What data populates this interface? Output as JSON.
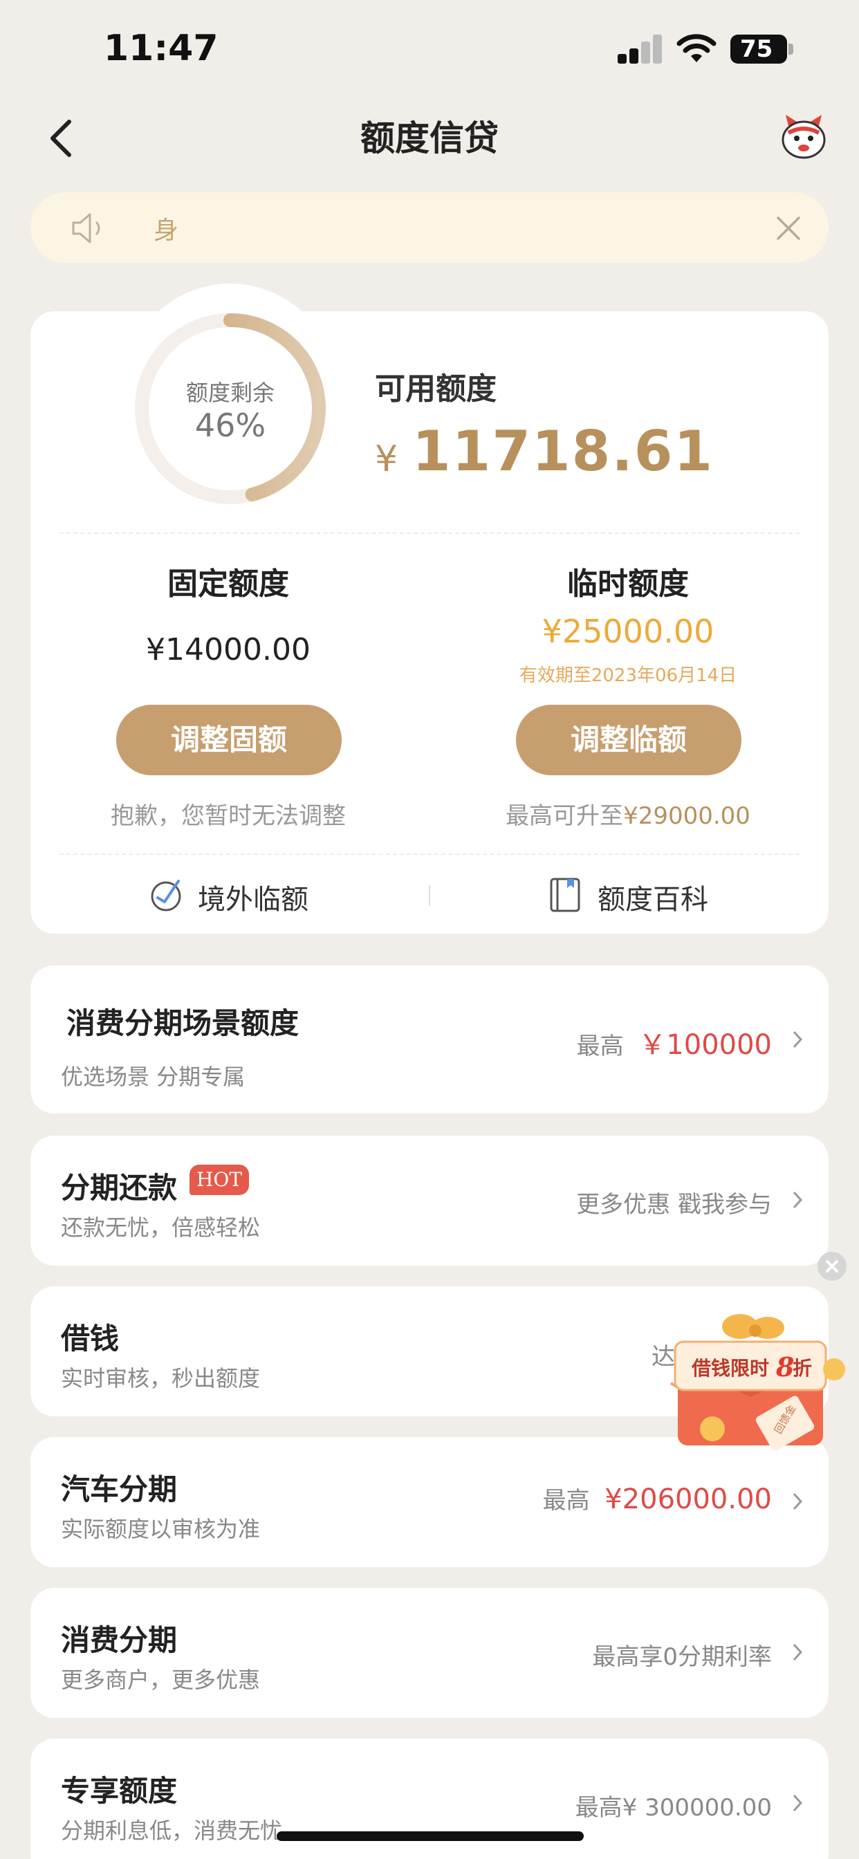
{
  "status_bar": {
    "time": "11:47",
    "battery": "75"
  },
  "nav": {
    "title": "额度信贷"
  },
  "notice": {
    "text": "⾝"
  },
  "quota": {
    "ring_label": "额度剩余",
    "ring_percent": "46%",
    "remaining_fraction": 0.46,
    "available_label": "可用额度",
    "currency": "¥",
    "available_amount": "11718.61",
    "fixed": {
      "label": "固定额度",
      "amount": "¥14000.00",
      "button": "调整固额",
      "note": "抱歉，您暂时无法调整"
    },
    "temporary": {
      "label": "临时额度",
      "amount": "¥25000.00",
      "validity": "有效期至2023年06月14日",
      "button": "调整临额",
      "note_prefix": "最高可升至",
      "note_amount": "¥29000.00"
    },
    "links": {
      "overseas": "境外临额",
      "wiki": "额度百科"
    }
  },
  "list": [
    {
      "title": "消费分期场景额度",
      "subtitle": "优选场景 分期专属",
      "right_prefix": "最高",
      "right_value": "￥100000"
    },
    {
      "title": "分期还款",
      "badge": "HOT",
      "subtitle": "还款无忧，倍感轻松",
      "right_text": "更多优惠 戳我参与"
    },
    {
      "title": "借钱",
      "subtitle": "实时审核，秒出额度",
      "right_text": "达"
    },
    {
      "title": "汽车分期",
      "subtitle": "实际额度以审核为准",
      "right_prefix": "最高",
      "right_value": "¥206000.00"
    },
    {
      "title": "消费分期",
      "subtitle": "更多商户，更多优惠",
      "right_text": "最高享0分期利率"
    },
    {
      "title": "专享额度",
      "subtitle": "分期利息低，消费无忧",
      "right_text": "最高¥ 300000.00"
    }
  ],
  "promo": {
    "text_a": "借钱限时",
    "text_b": "8",
    "text_c": "折",
    "ticket": "回馈金"
  },
  "colors": {
    "accent": "#c79e6e",
    "gold": "#b8905c",
    "orange": "#ecaa3a",
    "red": "#e04a45",
    "background": "#f1ede8"
  }
}
